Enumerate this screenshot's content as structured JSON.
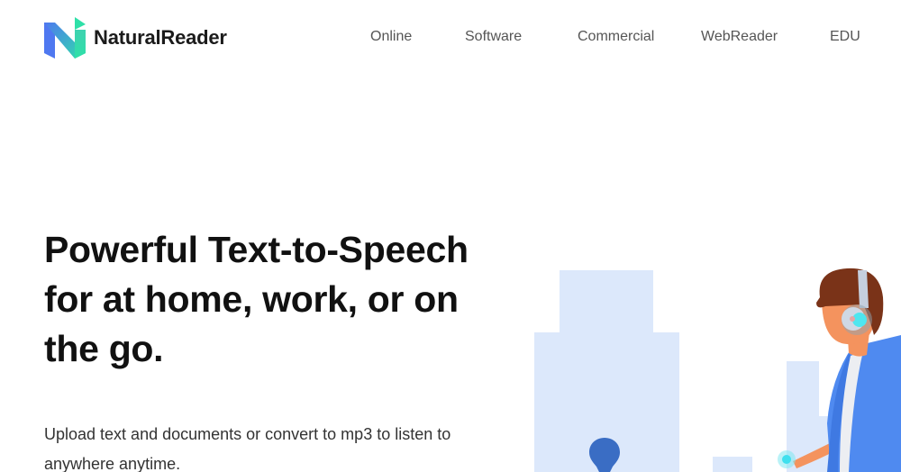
{
  "brand": {
    "name": "NaturalReader",
    "logo_icon": "n-logo-icon",
    "colors": {
      "gradient_start": "#4f78f0",
      "gradient_end": "#2ee0a8",
      "accent_blue": "#4f8af0",
      "building": "#dce8fb",
      "pin": "#3a6dc4"
    }
  },
  "nav": {
    "items": [
      {
        "label": "Online"
      },
      {
        "label": "Software"
      },
      {
        "label": "Commercial"
      },
      {
        "label": "WebReader"
      },
      {
        "label": "EDU"
      }
    ]
  },
  "hero": {
    "title_lines": [
      "Powerful Text-to-Speech",
      "for at home, work, or on",
      "the go."
    ],
    "subtitle_lines": [
      "Upload text and documents or convert to mp3 to listen to",
      "anywhere anytime."
    ],
    "illustration": "person-with-headphones-city-illustration"
  }
}
